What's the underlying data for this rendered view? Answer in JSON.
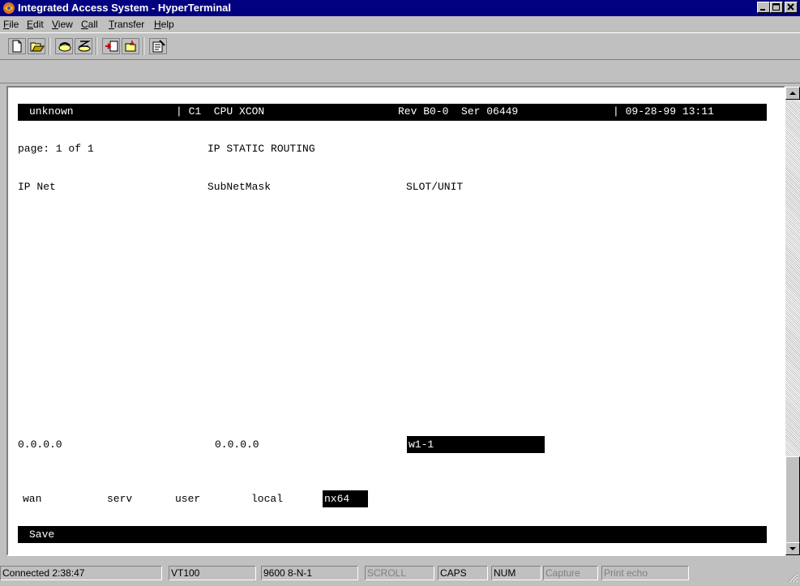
{
  "window": {
    "title": "Integrated Access System - HyperTerminal"
  },
  "menu": [
    {
      "label": "File",
      "accel": "F",
      "rest": "ile"
    },
    {
      "label": "Edit",
      "accel": "E",
      "rest": "dit"
    },
    {
      "label": "View",
      "accel": "V",
      "rest": "iew"
    },
    {
      "label": "Call",
      "accel": "C",
      "rest": "all"
    },
    {
      "label": "Transfer",
      "accel": "T",
      "rest": "ransfer"
    },
    {
      "label": "Help",
      "accel": "H",
      "rest": "elp"
    }
  ],
  "toolbar": {
    "icons": [
      "new-icon",
      "open-icon",
      "connect-icon",
      "disconnect-icon",
      "send-icon",
      "receive-icon",
      "properties-icon"
    ]
  },
  "terminal": {
    "header": {
      "name": "unknown",
      "card": "| C1  CPU XCON",
      "rev": "Rev B0-0  Ser 06449",
      "datetime": "| 09-28-99 13:11"
    },
    "page_label": "page: 1 of 1",
    "screen_title": "IP STATIC ROUTING",
    "columns": [
      "IP Net",
      "SubNetMask",
      "SLOT/UNIT"
    ],
    "entry": {
      "ip_net": "0.0.0.0",
      "subnet_mask": "0.0.0.0",
      "slot_unit": "w1-1"
    },
    "options": [
      "wan",
      "serv",
      "user",
      "local",
      "nx64"
    ],
    "selected_option": "nx64",
    "command": "Save"
  },
  "status": {
    "connected": "Connected 2:38:47",
    "emulation": "VT100",
    "settings": "9600 8-N-1",
    "scroll": "SCROLL",
    "caps": "CAPS",
    "num": "NUM",
    "capture": "Capture",
    "print_echo": "Print echo"
  },
  "colors": {
    "titlebar": "#000080",
    "window": "#c0c0c0",
    "terminal_bg": "#ffffff",
    "inverse_bg": "#000000"
  }
}
